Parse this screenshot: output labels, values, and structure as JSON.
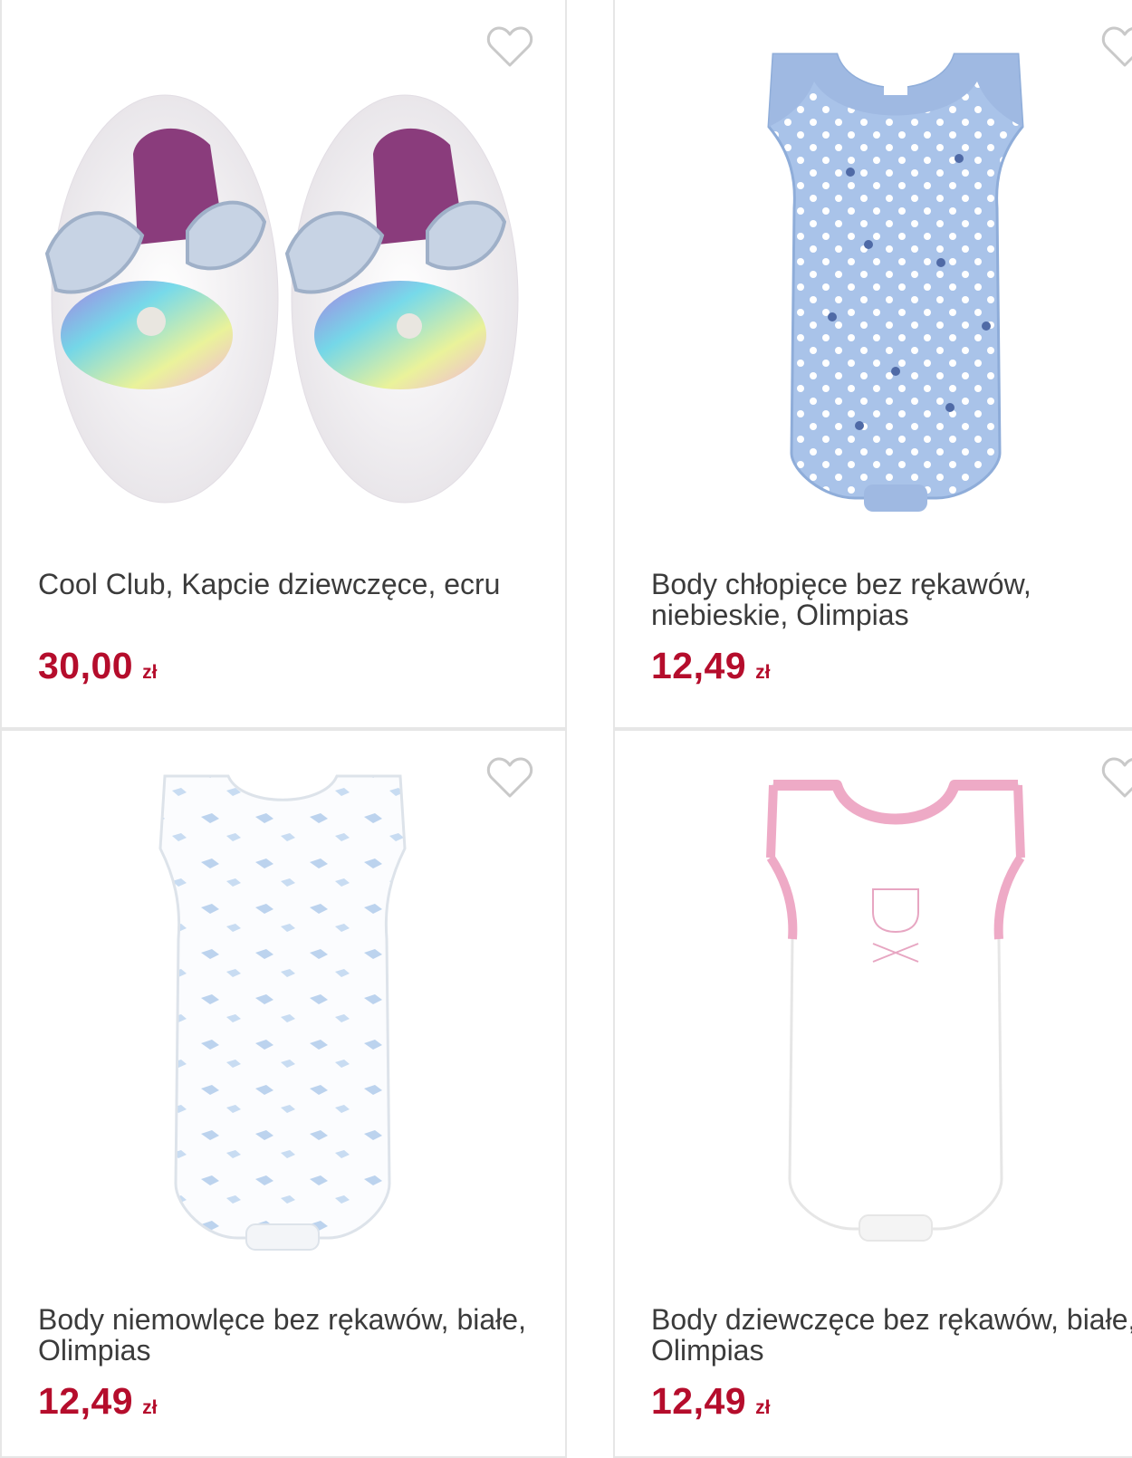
{
  "colors": {
    "price": "#b50d2c",
    "text": "#3b3b3b",
    "border": "#e6e6e6",
    "heart": "#c9c9c9"
  },
  "products": [
    {
      "name": "Cool Club, Kapcie dziewczęce, ecru",
      "price": "30,00",
      "currency": "zł",
      "image": "fairy-slippers-image",
      "favorite_icon": "heart-outline-icon"
    },
    {
      "name": "Body chłopięce bez rękawów, niebieskie, Olimpias",
      "price": "12,49",
      "currency": "zł",
      "image": "blue-polka-dot-bodysuit-image",
      "favorite_icon": "heart-outline-icon"
    },
    {
      "name": "Body niemowlęce bez rękawów, białe, Olimpias",
      "price": "12,49",
      "currency": "zł",
      "image": "white-blue-print-bodysuit-image",
      "favorite_icon": "heart-outline-icon"
    },
    {
      "name": "Body dziewczęce bez rękawów, białe, Olimpias",
      "price": "12,49",
      "currency": "zł",
      "image": "white-pink-trim-bodysuit-image",
      "favorite_icon": "heart-outline-icon"
    }
  ]
}
